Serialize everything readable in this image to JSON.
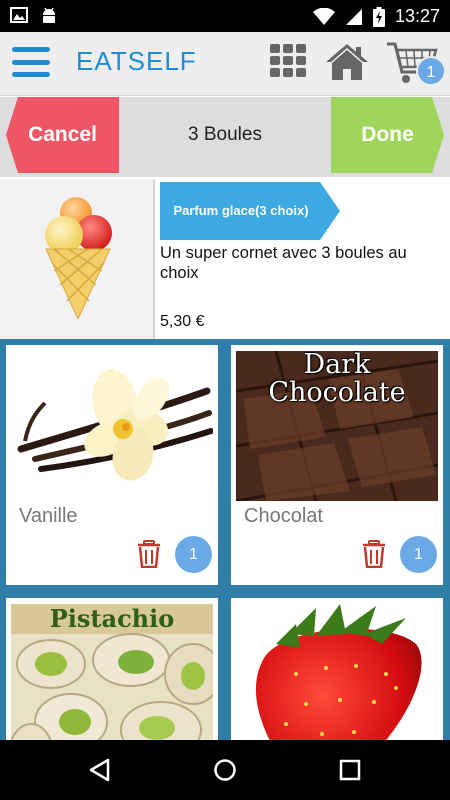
{
  "status_bar": {
    "time": "13:27",
    "left_icons": [
      "image-icon",
      "android-icon"
    ],
    "right_icons": [
      "wifi-icon",
      "signal-icon",
      "battery-icon"
    ]
  },
  "app_bar": {
    "title": "EATSELF",
    "menu_icon": "hamburger-icon",
    "icons": [
      "grid-icon",
      "home-icon",
      "cart-icon"
    ],
    "cart_count": "1",
    "accent_color": "#1f8bd1"
  },
  "action_bar": {
    "cancel_label": "Cancel",
    "title": "3 Boules",
    "done_label": "Done",
    "cancel_color": "#ee5565",
    "done_color": "#9fd55a"
  },
  "product": {
    "category": "Parfum glace(3 choix)",
    "description": "Un super cornet avec 3 boules au choix",
    "price": "5,30 €",
    "image_icon": "ice-cream-cone-icon",
    "category_color": "#3ca9e2"
  },
  "options": {
    "items": [
      {
        "name": "Vanille",
        "quantity": "1",
        "image": "vanilla-flower-image"
      },
      {
        "name": "Chocolat",
        "quantity": "1",
        "image": "dark-chocolate-image",
        "image_text_1": "Dark",
        "image_text_2": "Chocolate"
      },
      {
        "name": "",
        "quantity": "",
        "image": "pistachio-image",
        "image_text": "Pistachio"
      },
      {
        "name": "",
        "quantity": "",
        "image": "strawberry-image"
      }
    ],
    "background_color": "#2e7ea8",
    "badge_color": "#6aa9e6",
    "trash_color": "#c0392b"
  },
  "nav_bar": {
    "buttons": [
      "back-icon",
      "home-circle-icon",
      "recents-icon"
    ]
  }
}
